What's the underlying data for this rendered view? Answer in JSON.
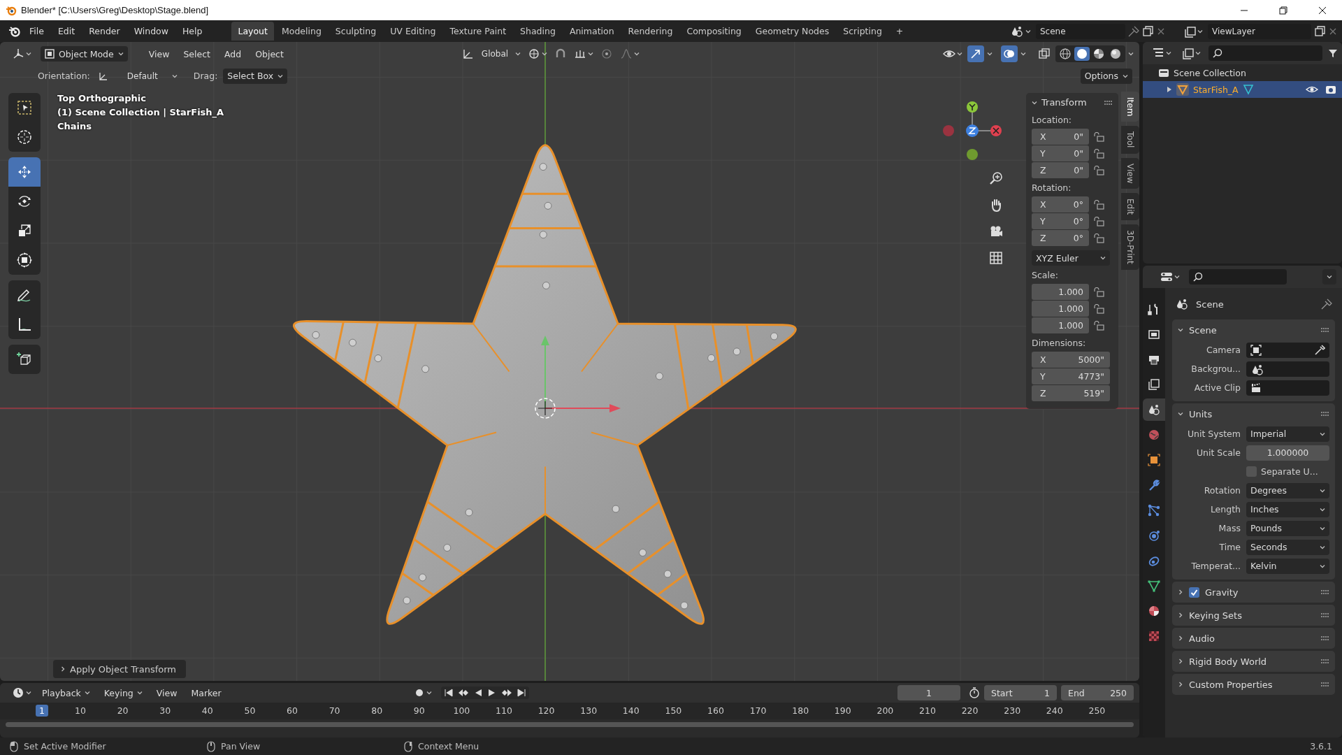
{
  "window": {
    "title": "Blender* [C:\\Users\\Greg\\Desktop\\Stage.blend]"
  },
  "menus": [
    "File",
    "Edit",
    "Render",
    "Window",
    "Help"
  ],
  "workspaces": [
    {
      "label": "Layout",
      "selected": true
    },
    {
      "label": "Modeling",
      "selected": false
    },
    {
      "label": "Sculpting",
      "selected": false
    },
    {
      "label": "UV Editing",
      "selected": false
    },
    {
      "label": "Texture Paint",
      "selected": false
    },
    {
      "label": "Shading",
      "selected": false
    },
    {
      "label": "Animation",
      "selected": false
    },
    {
      "label": "Rendering",
      "selected": false
    },
    {
      "label": "Compositing",
      "selected": false
    },
    {
      "label": "Geometry Nodes",
      "selected": false
    },
    {
      "label": "Scripting",
      "selected": false
    }
  ],
  "add_workspace": "+",
  "scene": "Scene",
  "view_layer": "ViewLayer",
  "viewport": {
    "mode": "Object Mode",
    "menus": [
      "View",
      "Select",
      "Add",
      "Object"
    ],
    "transform_orientation": "Global",
    "shading": [
      {
        "kind": "wireframe",
        "selected": false
      },
      {
        "kind": "solid",
        "selected": true
      },
      {
        "kind": "material",
        "selected": false
      },
      {
        "kind": "rendered",
        "selected": false
      }
    ],
    "orientation_label": "Orientation:",
    "orientation": "Default",
    "drag_label": "Drag:",
    "drag": "Select Box",
    "options": "Options",
    "tools": [
      {
        "kind": "select",
        "selected": false
      },
      {
        "kind": "cursor",
        "selected": false
      },
      {
        "kind": "move",
        "selected": true
      },
      {
        "kind": "rotate",
        "selected": false
      },
      {
        "kind": "scale",
        "selected": false
      },
      {
        "kind": "transform",
        "selected": false
      },
      {
        "kind": "annotate",
        "selected": false
      },
      {
        "kind": "measure",
        "selected": false
      },
      {
        "kind": "add-cube",
        "selected": false
      }
    ],
    "info": [
      "Top Orthographic",
      "(1) Scene Collection | StarFish_A",
      "Chains"
    ],
    "last_operator": "Apply Object Transform",
    "sidebar_tabs": [
      {
        "label": "Item",
        "selected": true
      },
      {
        "label": "Tool",
        "selected": false
      },
      {
        "label": "View",
        "selected": false
      },
      {
        "label": "Edit",
        "selected": false
      },
      {
        "label": "3D-Print",
        "selected": false
      }
    ],
    "transform": {
      "title": "Transform",
      "groups": [
        {
          "label": "Location:",
          "locks": true,
          "fields": [
            {
              "axis": "X",
              "value": "0\""
            },
            {
              "axis": "Y",
              "value": "0\""
            },
            {
              "axis": "Z",
              "value": "0\""
            }
          ]
        },
        {
          "label": "Rotation:",
          "locks": true,
          "fields": [
            {
              "axis": "X",
              "value": "0°"
            },
            {
              "axis": "Y",
              "value": "0°"
            },
            {
              "axis": "Z",
              "value": "0°"
            }
          ],
          "mode": "XYZ Euler"
        },
        {
          "label": "Scale:",
          "locks": true,
          "fields": [
            {
              "value": "1.000"
            },
            {
              "value": "1.000"
            },
            {
              "value": "1.000"
            }
          ]
        },
        {
          "label": "Dimensions:",
          "locks": false,
          "fields": [
            {
              "axis": "X",
              "value": "5000\""
            },
            {
              "axis": "Y",
              "value": "4773\""
            },
            {
              "axis": "Z",
              "value": "519\""
            }
          ]
        }
      ]
    }
  },
  "outliner": {
    "root": "Scene Collection",
    "items": [
      {
        "label": "StarFish_A",
        "selected": true
      }
    ]
  },
  "properties": {
    "context": "Scene",
    "tabs": [
      {
        "kind": "tool",
        "selected": false
      },
      {
        "kind": "render",
        "selected": false
      },
      {
        "kind": "output",
        "selected": false
      },
      {
        "kind": "view-layer",
        "selected": false
      },
      {
        "kind": "scene",
        "selected": true
      },
      {
        "kind": "world",
        "selected": false
      },
      {
        "kind": "object",
        "selected": false
      },
      {
        "kind": "modifiers",
        "selected": false
      },
      {
        "kind": "particles",
        "selected": false
      },
      {
        "kind": "physics",
        "selected": false
      },
      {
        "kind": "constraints",
        "selected": false
      },
      {
        "kind": "data",
        "selected": false
      },
      {
        "kind": "material",
        "selected": false
      },
      {
        "kind": "texture",
        "selected": false
      }
    ],
    "panels": [
      {
        "title": "Scene",
        "kind": "plain",
        "expanded": true,
        "rows": [
          {
            "kind": "camera",
            "label": "Camera"
          },
          {
            "kind": "scene",
            "label": "Backgrou..."
          },
          {
            "kind": "clip",
            "label": "Active Clip"
          }
        ]
      },
      {
        "title": "Units",
        "kind": "plain",
        "expanded": true,
        "rows": [
          {
            "kind": "dropdown",
            "label": "Unit System",
            "value": "Imperial"
          },
          {
            "kind": "number",
            "label": "Unit Scale",
            "value": "1.000000"
          },
          {
            "kind": "checkbox",
            "label": "Separate U...",
            "checked": false
          },
          {
            "kind": "dropdown",
            "label": "Rotation",
            "value": "Degrees"
          },
          {
            "kind": "dropdown",
            "label": "Length",
            "value": "Inches"
          },
          {
            "kind": "dropdown",
            "label": "Mass",
            "value": "Pounds"
          },
          {
            "kind": "dropdown",
            "label": "Time",
            "value": "Seconds"
          },
          {
            "kind": "dropdown",
            "label": "Temperat...",
            "value": "Kelvin"
          }
        ]
      },
      {
        "title": "Gravity",
        "kind": "toggle",
        "checked": true,
        "expanded": false
      },
      {
        "title": "Keying Sets",
        "kind": "plain",
        "expanded": false
      },
      {
        "title": "Audio",
        "kind": "plain",
        "expanded": false
      },
      {
        "title": "Rigid Body World",
        "kind": "plain",
        "expanded": false
      },
      {
        "title": "Custom Properties",
        "kind": "plain",
        "expanded": false
      }
    ]
  },
  "timeline": {
    "menus": [
      "Playback",
      "Keying",
      "View",
      "Marker"
    ],
    "current_frame": "1",
    "start_label": "Start",
    "start": "1",
    "end_label": "End",
    "end": "250",
    "ruler": [
      {
        "label": "1",
        "selected": true
      },
      {
        "label": "10",
        "selected": false
      },
      {
        "label": "20",
        "selected": false
      },
      {
        "label": "30",
        "selected": false
      },
      {
        "label": "40",
        "selected": false
      },
      {
        "label": "50",
        "selected": false
      },
      {
        "label": "60",
        "selected": false
      },
      {
        "label": "70",
        "selected": false
      },
      {
        "label": "80",
        "selected": false
      },
      {
        "label": "90",
        "selected": false
      },
      {
        "label": "100",
        "selected": false
      },
      {
        "label": "110",
        "selected": false
      },
      {
        "label": "120",
        "selected": false
      },
      {
        "label": "130",
        "selected": false
      },
      {
        "label": "140",
        "selected": false
      },
      {
        "label": "150",
        "selected": false
      },
      {
        "label": "160",
        "selected": false
      },
      {
        "label": "170",
        "selected": false
      },
      {
        "label": "180",
        "selected": false
      },
      {
        "label": "190",
        "selected": false
      },
      {
        "label": "200",
        "selected": false
      },
      {
        "label": "210",
        "selected": false
      },
      {
        "label": "220",
        "selected": false
      },
      {
        "label": "230",
        "selected": false
      },
      {
        "label": "240",
        "selected": false
      },
      {
        "label": "250",
        "selected": false
      }
    ]
  },
  "status_bar": {
    "items": [
      {
        "kind": "mouse-left",
        "label": "Set Active Modifier"
      },
      {
        "kind": "mouse-middle",
        "label": "Pan View"
      },
      {
        "kind": "mouse-right",
        "label": "Context Menu"
      }
    ],
    "version": "3.6.1"
  }
}
